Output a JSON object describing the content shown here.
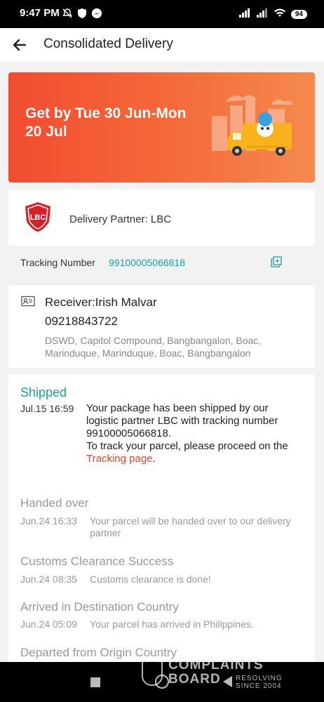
{
  "status_bar": {
    "time": "9:47 PM",
    "battery": "94",
    "icons": [
      "mute-icon",
      "shield-icon",
      "messenger-icon",
      "signal-icon",
      "signal-icon",
      "wifi-icon",
      "battery-icon"
    ]
  },
  "app_bar": {
    "title": "Consolidated Delivery",
    "back_icon": "back-arrow-icon"
  },
  "banner": {
    "eta": "Get by Tue 30 Jun-Mon 20 Jul"
  },
  "partner": {
    "logo_text": "LBC",
    "label": "Delivery Partner: LBC"
  },
  "tracking": {
    "label": "Tracking Number",
    "number": "99100005066818"
  },
  "receiver": {
    "name": "Receiver:Irish Malvar",
    "phone": "09218843722",
    "address": "DSWD, Capitol Compound, Bangbangalon, Boac, Marinduque, Marinduque, Boac, Bangbangalon"
  },
  "timeline": {
    "current": {
      "status": "Shipped",
      "time": "Jul.15 16:59",
      "description": "Your package has been shipped by our logistic partner LBC with tracking number 99100005066818.",
      "description2": " To track your parcel, please proceed on the ",
      "link": "Tracking page",
      "end": "."
    },
    "events": [
      {
        "status": "Handed over",
        "time": "Jun.24 16:33",
        "description": "Your parcel will be handed over to our delivery partner"
      },
      {
        "status": "Customs Clearance Success",
        "time": "Jun.24 08:35",
        "description": "Customs clearance is done!"
      },
      {
        "status": "Arrived in Destination Country",
        "time": "Jun.24 05:09",
        "description": "Your parcel has arrived in Philippines."
      },
      {
        "status": "Departed from Origin Country",
        "time": "",
        "description": ""
      }
    ]
  },
  "watermark": {
    "line1": "COMPLAINTS",
    "line2": "BOARD",
    "line3": "RESOLVING",
    "line4": "SINCE 2004"
  }
}
